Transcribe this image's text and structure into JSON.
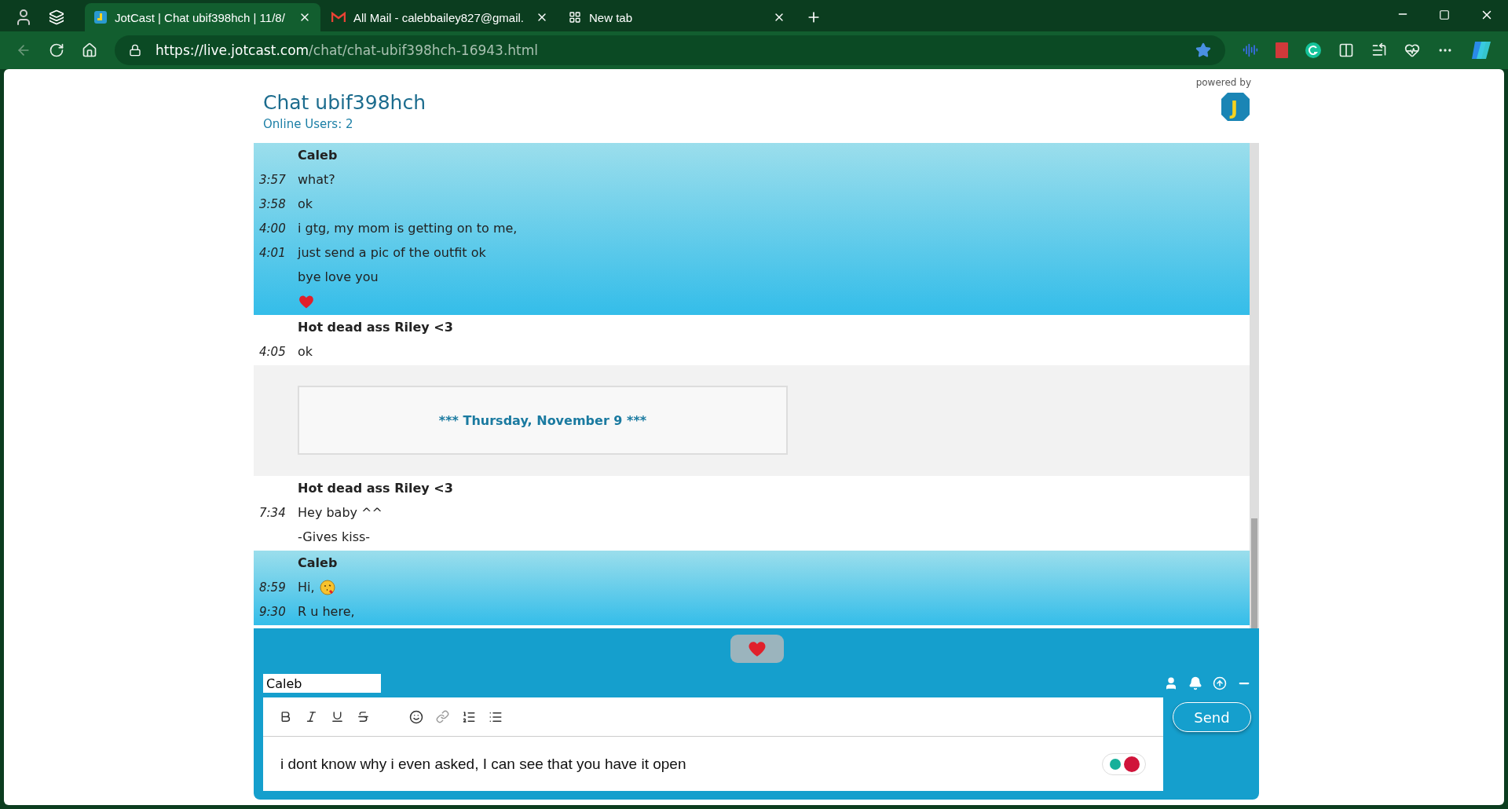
{
  "browser": {
    "tabs": [
      {
        "title": "JotCast | Chat ubif398hch | 11/8/",
        "selected": true,
        "kind": "jotcast"
      },
      {
        "title": "All Mail - calebbailey827@gmail.",
        "selected": false,
        "kind": "mail"
      },
      {
        "title": "New tab",
        "selected": false,
        "kind": "newtab"
      }
    ],
    "url_host": "https://live.jotcast.com",
    "url_path": "/chat/chat-ubif398hch-16943.html"
  },
  "chat": {
    "title": "Chat ubif398hch",
    "online_users": "Online Users: 2",
    "powered_by": "powered by",
    "logo_letter": "J",
    "groups": [
      {
        "kind": "user",
        "author": "Caleb",
        "mine": true,
        "lines": [
          {
            "time": "3:57",
            "text": "what?"
          },
          {
            "time": "3:58",
            "text": "ok"
          },
          {
            "time": "4:00",
            "text": "i gtg, my mom is getting on to me,"
          },
          {
            "time": "4:01",
            "text": "just send a pic of the outfit ok"
          },
          {
            "text": "bye love you"
          },
          {
            "kind": "heart"
          }
        ]
      },
      {
        "kind": "user",
        "author": "Hot dead ass Riley <3",
        "mine": false,
        "lines": [
          {
            "time": "4:05",
            "text": "ok"
          }
        ]
      },
      {
        "kind": "date",
        "text": "*** Thursday, November 9 ***"
      },
      {
        "kind": "user",
        "author": "Hot dead ass Riley <3",
        "mine": false,
        "lines": [
          {
            "time": "7:34",
            "text": "Hey baby ^^"
          },
          {
            "text": "-Gives kiss-"
          }
        ]
      },
      {
        "kind": "user",
        "author": "Caleb",
        "mine": true,
        "lines": [
          {
            "time": "8:59",
            "text": "Hi,",
            "emoji": true
          },
          {
            "time": "9:30",
            "text": "R u here,"
          }
        ]
      }
    ]
  },
  "composer": {
    "name": "Caleb",
    "message": "i dont know why i even asked, I can see that you have it open",
    "send": "Send"
  }
}
